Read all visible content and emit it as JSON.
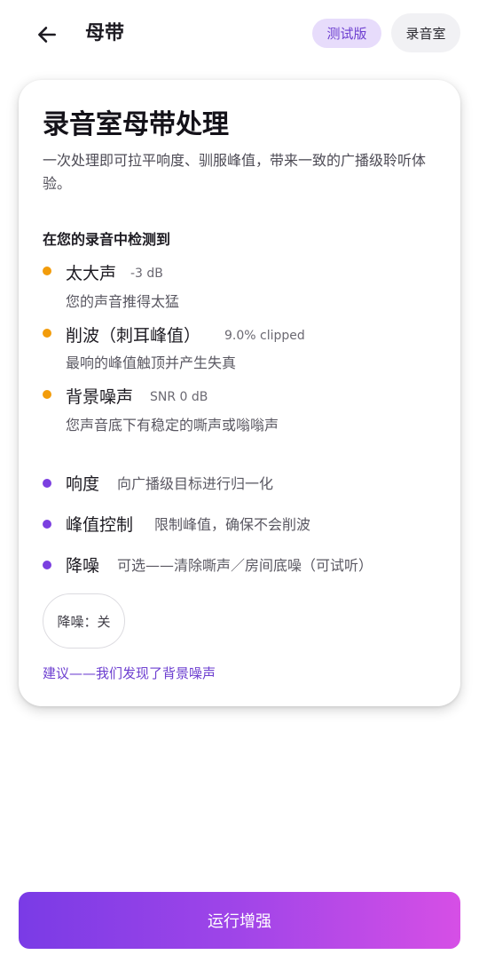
{
  "header": {
    "title": "母带",
    "beta_chip": "测试版",
    "studio_chip": "录音室"
  },
  "card": {
    "title": "录音室母带处理",
    "description": "一次处理即可拉平响度、驯服峰值，带来一致的广播级聆听体验。",
    "detected_title": "在您的录音中检测到",
    "issues": [
      {
        "name": "太大声",
        "metric": "-3 dB",
        "description": "您的声音推得太猛"
      },
      {
        "name": "削波（刺耳峰值）",
        "metric": "9.0% clipped",
        "description": "最响的峰值触顶并产生失真"
      },
      {
        "name": "背景噪声",
        "metric": "SNR 0 dB",
        "description": "您声音底下有稳定的嘶声或嗡嗡声"
      }
    ],
    "features": [
      {
        "name": "响度",
        "description": "向广播级目标进行归一化"
      },
      {
        "name": "峰值控制",
        "description": "限制峰值，确保不会削波"
      },
      {
        "name": "降噪",
        "description": "可选——清除嘶声／房间底噪（可试听）"
      }
    ],
    "noise_reduction_toggle": "降噪：关",
    "suggestion": "建议——我们发现了背景噪声"
  },
  "run_button": "运行增强",
  "colors": {
    "accent": "#7b3fe0",
    "warning": "#f29c0b",
    "beta_chip_bg": "#e7dcfb"
  }
}
